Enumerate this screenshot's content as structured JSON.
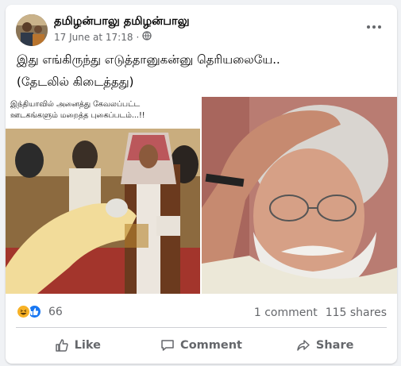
{
  "post": {
    "author": "தமிழன்பாலு தமிழன்பாலு",
    "timestamp": "17 June at 17:18",
    "audience_icon": "globe-icon",
    "more_icon": "more-options-icon",
    "text_line1": "இது எங்கிருந்து எடுத்தானுகன்னு தெரியலையே..",
    "text_line2": "(தேடலில் கிடைத்தது)"
  },
  "images": {
    "left_caption_line1": "இந்தியாவில் அனைத்து கேவலப்பட்ட",
    "left_caption_line2": "ஊடகங்களும் மறைத்த புகைப்படம்...!!"
  },
  "engagement": {
    "reaction_icons": [
      "haha-icon",
      "like-icon"
    ],
    "reaction_count": "66",
    "comments": "1 comment",
    "shares": "115 shares"
  },
  "actions": {
    "like_label": "Like",
    "comment_label": "Comment",
    "share_label": "Share"
  },
  "colors": {
    "brand_blue": "#1877f2",
    "haha_yellow": "#f7b125",
    "secondary_text": "#65676b",
    "divider": "#ced0d4"
  }
}
